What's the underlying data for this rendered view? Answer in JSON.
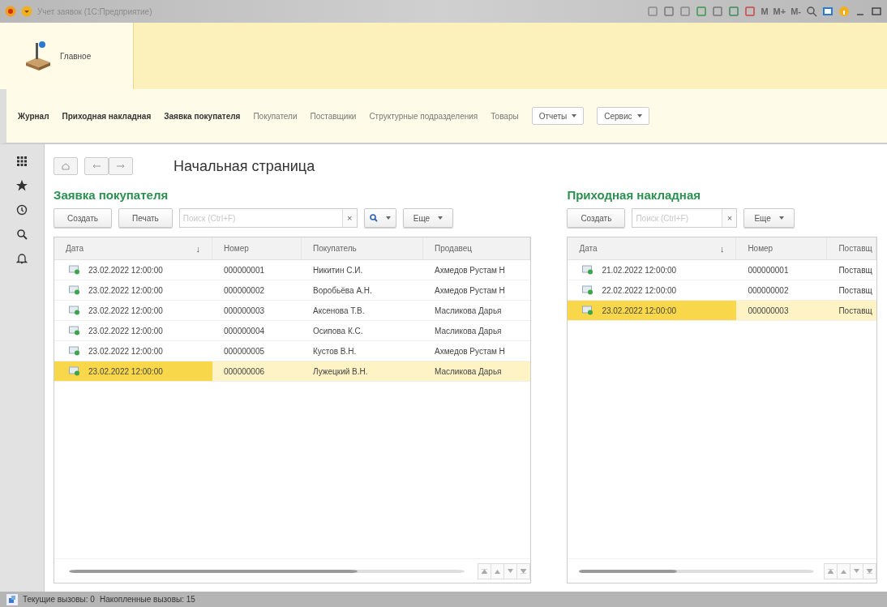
{
  "window": {
    "title": "Учет заявок (1С:Предприятие)",
    "memory_buttons": [
      "M",
      "M+",
      "M-"
    ]
  },
  "sections": [
    {
      "label": "Главное",
      "selected": true
    }
  ],
  "nav": [
    {
      "label": "Журнал",
      "kind": "link",
      "bold": true
    },
    {
      "label": "Приходная накладная",
      "kind": "link",
      "bold": true
    },
    {
      "label": "Заявка покупателя",
      "kind": "link",
      "bold": true
    },
    {
      "label": "Покупатели",
      "kind": "link",
      "bold": false
    },
    {
      "label": "Поставщики",
      "kind": "link",
      "bold": false
    },
    {
      "label": "Структурные подразделения",
      "kind": "link",
      "bold": false
    },
    {
      "label": "Товары",
      "kind": "link",
      "bold": false
    },
    {
      "label": "Отчеты",
      "kind": "menu"
    },
    {
      "label": "Сервис",
      "kind": "menu"
    }
  ],
  "page_title": "Начальная страница",
  "panels": [
    {
      "title": "Заявка покупателя",
      "buttons": [
        "Создать",
        "Печать"
      ],
      "search": {
        "placeholder": "Поиск (Ctrl+F)",
        "clear": "×"
      },
      "search_button": true,
      "more": "Еще",
      "columns": [
        {
          "label": "Дата",
          "sort_mark": "↓"
        },
        {
          "label": "Номер"
        },
        {
          "label": "Покупатель"
        },
        {
          "label": "Продавец"
        }
      ],
      "rows": [
        {
          "cells": [
            "23.02.2022 12:00:00",
            "000000001",
            "Никитин С.И.",
            "Ахмедов Рустам Н"
          ],
          "selected": false
        },
        {
          "cells": [
            "23.02.2022 12:00:00",
            "000000002",
            "Воробьёва А.Н.",
            "Ахмедов Рустам Н"
          ],
          "selected": false
        },
        {
          "cells": [
            "23.02.2022 12:00:00",
            "000000003",
            "Аксенова Т.В.",
            "Масликова Дарья"
          ],
          "selected": false
        },
        {
          "cells": [
            "23.02.2022 12:00:00",
            "000000004",
            "Осипова К.С.",
            "Масликова Дарья"
          ],
          "selected": false
        },
        {
          "cells": [
            "23.02.2022 12:00:00",
            "000000005",
            "Кустов В.Н.",
            "Ахмедов Рустам Н"
          ],
          "selected": false
        },
        {
          "cells": [
            "23.02.2022 12:00:00",
            "000000006",
            "Лужецкий В.Н.",
            "Масликова Дарья"
          ],
          "selected": true
        }
      ]
    },
    {
      "title": "Приходная накладная",
      "buttons": [
        "Создать"
      ],
      "search": {
        "placeholder": "Поиск (Ctrl+F)",
        "clear": "×"
      },
      "search_button": false,
      "more": "Еще",
      "columns": [
        {
          "label": "Дата",
          "sort_mark": "↓"
        },
        {
          "label": "Номер"
        },
        {
          "label": "Поставщ"
        }
      ],
      "rows": [
        {
          "cells": [
            "21.02.2022 12:00:00",
            "000000001",
            "Поставщ"
          ],
          "selected": false
        },
        {
          "cells": [
            "22.02.2022 12:00:00",
            "000000002",
            "Поставщ"
          ],
          "selected": false
        },
        {
          "cells": [
            "23.02.2022 12:00:00",
            "000000003",
            "Поставщ"
          ],
          "selected": true
        }
      ]
    }
  ],
  "status_bar": [
    "Текущие вызовы: 0",
    "Накопленные вызовы: 15"
  ]
}
